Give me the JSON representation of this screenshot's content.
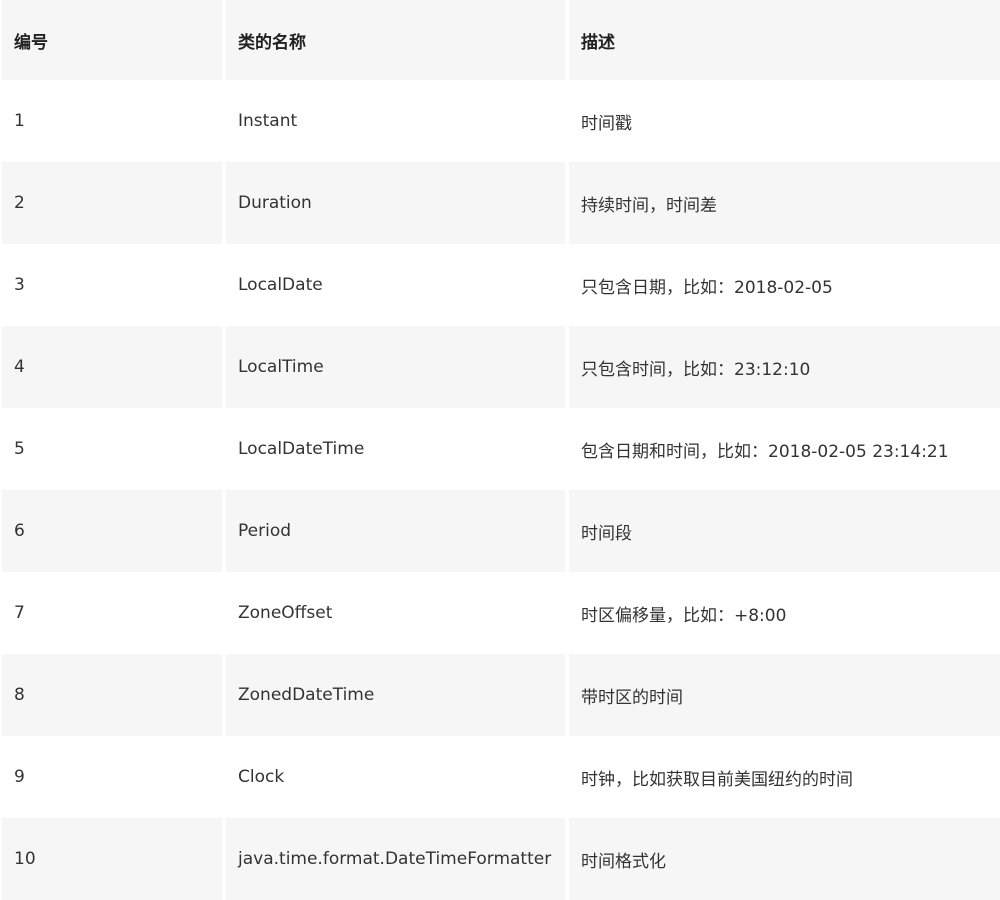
{
  "headers": {
    "number": "编号",
    "class_name": "类的名称",
    "description": "描述"
  },
  "rows": [
    {
      "number": "1",
      "class_name": "Instant",
      "description": "时间戳"
    },
    {
      "number": "2",
      "class_name": "Duration",
      "description": "持续时间，时间差"
    },
    {
      "number": "3",
      "class_name": "LocalDate",
      "description": "只包含日期，比如：2018-02-05"
    },
    {
      "number": "4",
      "class_name": "LocalTime",
      "description": "只包含时间，比如：23:12:10"
    },
    {
      "number": "5",
      "class_name": "LocalDateTime",
      "description": "包含日期和时间，比如：2018-02-05 23:14:21"
    },
    {
      "number": "6",
      "class_name": "Period",
      "description": "时间段"
    },
    {
      "number": "7",
      "class_name": "ZoneOffset",
      "description": "时区偏移量，比如：+8:00"
    },
    {
      "number": "8",
      "class_name": "ZonedDateTime",
      "description": "带时区的时间"
    },
    {
      "number": "9",
      "class_name": "Clock",
      "description": "时钟，比如获取目前美国纽约的时间"
    },
    {
      "number": "10",
      "class_name": "java.time.format.DateTimeFormatter",
      "description": "时间格式化"
    }
  ]
}
